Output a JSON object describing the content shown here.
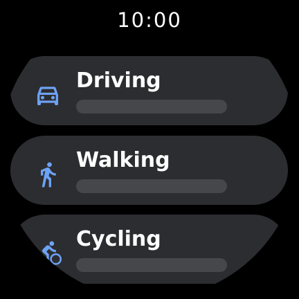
{
  "status": {
    "time": "10:00"
  },
  "colors": {
    "background": "#000000",
    "chip": "#2c2d30",
    "placeholder_bar": "#46474a",
    "icon_accent": "#6ea2f5",
    "text": "#ffffff"
  },
  "modes": [
    {
      "label": "Driving",
      "icon": "car-icon"
    },
    {
      "label": "Walking",
      "icon": "walking-icon"
    },
    {
      "label": "Cycling",
      "icon": "bicycle-icon"
    }
  ]
}
